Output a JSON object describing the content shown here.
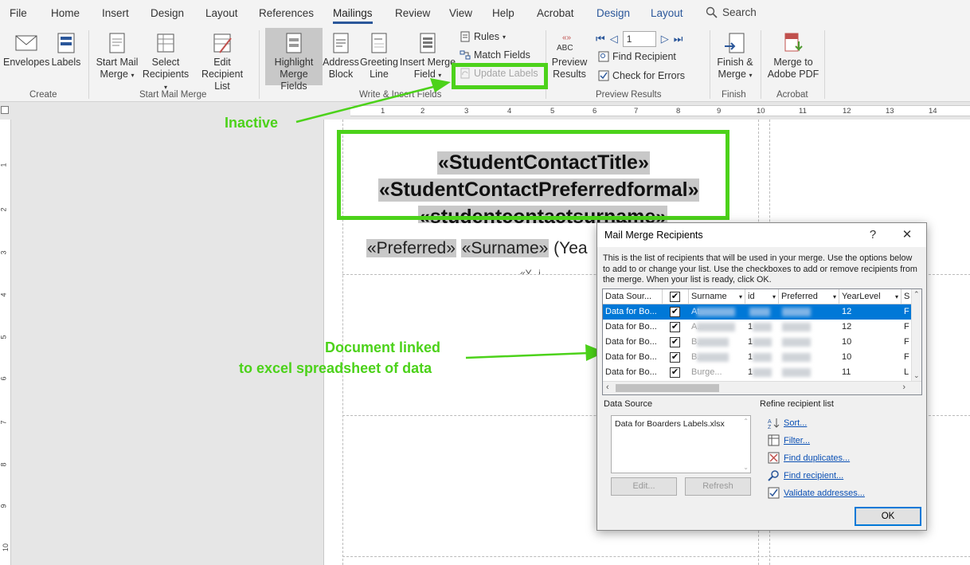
{
  "tabs": [
    {
      "label": "File"
    },
    {
      "label": "Home"
    },
    {
      "label": "Insert"
    },
    {
      "label": "Design"
    },
    {
      "label": "Layout"
    },
    {
      "label": "References"
    },
    {
      "label": "Mailings"
    },
    {
      "label": "Review"
    },
    {
      "label": "View"
    },
    {
      "label": "Help"
    },
    {
      "label": "Acrobat"
    },
    {
      "label": "Design"
    },
    {
      "label": "Layout"
    }
  ],
  "search": {
    "label": "Search"
  },
  "ribbon": {
    "envelopes": "Envelopes",
    "labels": "Labels",
    "start_mail_merge": [
      "Start Mail",
      "Merge"
    ],
    "select_recipients": [
      "Select",
      "Recipients"
    ],
    "edit_recipient_list": [
      "Edit",
      "Recipient List"
    ],
    "highlight_merge_fields": [
      "Highlight",
      "Merge Fields"
    ],
    "address_block": [
      "Address",
      "Block"
    ],
    "greeting_line": [
      "Greeting",
      "Line"
    ],
    "insert_merge_field": [
      "Insert Merge",
      "Field"
    ],
    "rules": "Rules",
    "match_fields": "Match Fields",
    "update_labels": "Update Labels",
    "preview_results": [
      "Preview",
      "Results"
    ],
    "preview_abc": "ABC",
    "record_number": "1",
    "find_recipient": "Find Recipient",
    "check_for_errors": "Check for Errors",
    "finish_merge": [
      "Finish &",
      "Merge"
    ],
    "merge_to_pdf": [
      "Merge to",
      "Adobe PDF"
    ],
    "groups": {
      "create": "Create",
      "start_mail_merge": "Start Mail Merge",
      "write_insert_fields": "Write & Insert Fields",
      "preview_results": "Preview Results",
      "finish": "Finish",
      "acrobat": "Acrobat"
    }
  },
  "ruler": {
    "h_ticks": [
      "1",
      "2",
      "3",
      "4",
      "5",
      "6",
      "7",
      "8",
      "9",
      "10",
      "11",
      "12",
      "13",
      "14"
    ],
    "v_ticks": [
      "1",
      "2",
      "3",
      "4",
      "5",
      "6",
      "7",
      "8",
      "9",
      "10"
    ]
  },
  "document": {
    "field_title": "«StudentContactTitle»",
    "field_preferred_formal": "«StudentContactPreferredformal»",
    "field_surname_contact": "«studentcontactsurname»",
    "field_preferred": "«Preferred»",
    "field_surname": "«Surname»",
    "field_year_partial": "(Yea",
    "field_partial_line": "«Y...i..."
  },
  "annotations": {
    "inactive": "Inactive",
    "linked_line1": "Document linked",
    "linked_line2": "to excel spreadsheet of data",
    "color": "#4cd21a"
  },
  "dialog": {
    "title": "Mail Merge Recipients",
    "help": "?",
    "close": "✕",
    "description": "This is the list of recipients that will be used in your merge.  Use the options below to add to or change your list.  Use the checkboxes to add or remove recipients from the merge.  When your list is ready, click OK.",
    "columns": [
      "Data Sour...",
      "",
      "Surname",
      "id",
      "Preferred",
      "YearLevel",
      "S"
    ],
    "rows": [
      {
        "source": "Data for Bo...",
        "checked": "✔",
        "surname": "At...",
        "id": "1...",
        "year": "12",
        "s": "F",
        "selected": true
      },
      {
        "source": "Data for Bo...",
        "checked": "✔",
        "surname": "A...",
        "id": "1",
        "year": "12",
        "s": "F",
        "selected": false
      },
      {
        "source": "Data for Bo...",
        "checked": "✔",
        "surname": "B...",
        "id": "1",
        "year": "10",
        "s": "F",
        "selected": false
      },
      {
        "source": "Data for Bo...",
        "checked": "✔",
        "surname": "B...",
        "id": "1",
        "year": "10",
        "s": "F",
        "selected": false
      },
      {
        "source": "Data for Bo...",
        "checked": "✔",
        "surname": "Burge...",
        "id": "1",
        "year": "11",
        "s": "L",
        "selected": false
      }
    ],
    "data_source_label": "Data Source",
    "data_source_file": "Data for Boarders Labels.xlsx",
    "edit_button": "Edit...",
    "refresh_button": "Refresh",
    "refine_label": "Refine recipient list",
    "refine_links": [
      "Sort...",
      "Filter...",
      "Find duplicates...",
      "Find recipient...",
      "Validate addresses..."
    ],
    "ok_button": "OK",
    "selection_color": "#0078d7"
  }
}
